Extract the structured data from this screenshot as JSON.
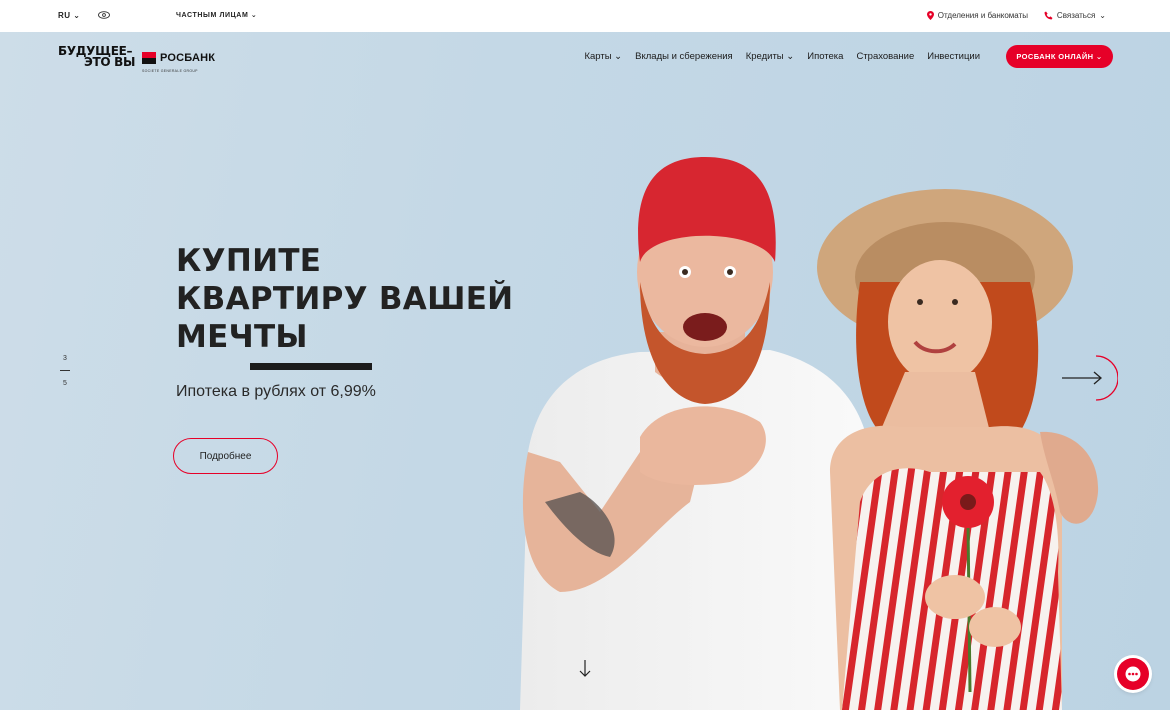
{
  "topbar": {
    "lang": "RU",
    "segment": "ЧАСТНЫМ ЛИЦАМ",
    "branches": "Отделения и банкоматы",
    "contact": "Связаться"
  },
  "logo": {
    "slogan_line1": "БУДУЩЕЕ–",
    "slogan_line2": "ЭТО ВЫ",
    "brand": "РОСБАНК",
    "group": "SOCIETE GENERALE GROUP"
  },
  "nav": {
    "items": [
      {
        "label": "Карты",
        "has_dropdown": true
      },
      {
        "label": "Вклады и сбережения",
        "has_dropdown": false
      },
      {
        "label": "Кредиты",
        "has_dropdown": true
      },
      {
        "label": "Ипотека",
        "has_dropdown": false
      },
      {
        "label": "Страхование",
        "has_dropdown": false
      },
      {
        "label": "Инвестиции",
        "has_dropdown": false
      }
    ],
    "online_label": "РОСБАНК ОНЛАЙН"
  },
  "hero": {
    "title_line1": "КУПИТЕ",
    "title_line2": "КВАРТИРУ ВАШЕЙ",
    "title_line3": "МЕЧТЫ",
    "subtitle": "Ипотека в рублях от 6,99%",
    "more_label": "Подробнее",
    "slide_current": "3",
    "slide_total": "5"
  },
  "colors": {
    "accent": "#e60028",
    "hero_bg": "#c4d8e6",
    "text": "#222222"
  },
  "icons": {
    "eye": "eye-icon",
    "pin": "map-pin-icon",
    "phone": "phone-icon",
    "next": "arrow-right-icon",
    "down": "arrow-down-icon",
    "chat": "chat-icon"
  }
}
